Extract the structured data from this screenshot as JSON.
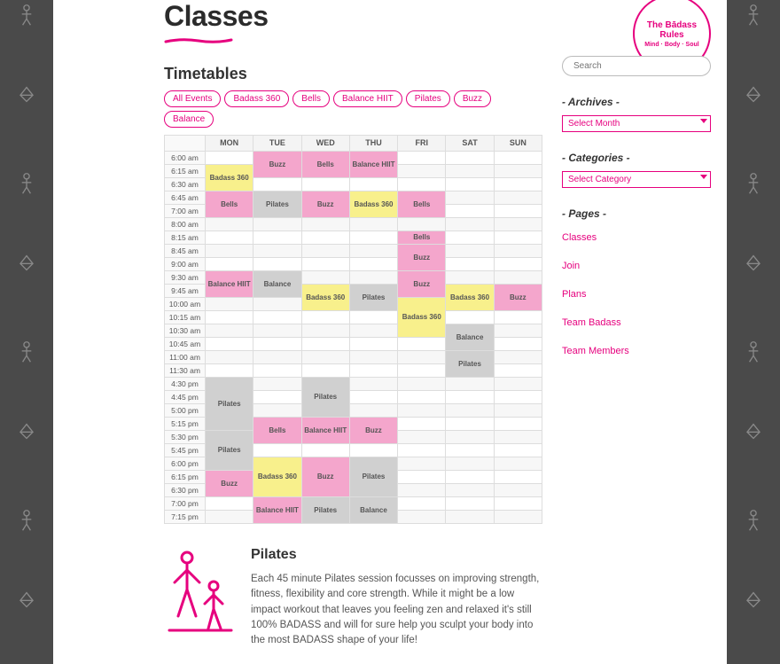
{
  "title": "Classes",
  "timetables_heading": "Timetables",
  "filters": [
    "All Events",
    "Badass 360",
    "Bells",
    "Balance HIIT",
    "Pilates",
    "Buzz",
    "Balance"
  ],
  "days": [
    "MON",
    "TUE",
    "WED",
    "THU",
    "FRI",
    "SAT",
    "SUN"
  ],
  "times": [
    "6:00 am",
    "6:15 am",
    "6:30 am",
    "6:45 am",
    "7:00 am",
    "8:00 am",
    "8:15 am",
    "8:45 am",
    "9:00 am",
    "9:30 am",
    "9:45 am",
    "10:00 am",
    "10:15 am",
    "10:30 am",
    "10:45 am",
    "11:00 am",
    "11:30 am",
    "4:30 pm",
    "4:45 pm",
    "5:00 pm",
    "5:15 pm",
    "5:30 pm",
    "5:45 pm",
    "6:00 pm",
    "6:15 pm",
    "6:30 pm",
    "7:00 pm",
    "7:15 pm"
  ],
  "events": [
    {
      "day": 0,
      "start": 1,
      "span": 2,
      "label": "Badass 360",
      "color": "yellow"
    },
    {
      "day": 0,
      "start": 3,
      "span": 2,
      "label": "Bells",
      "color": "pink"
    },
    {
      "day": 0,
      "start": 9,
      "span": 2,
      "label": "Balance HIIT",
      "color": "pink"
    },
    {
      "day": 0,
      "start": 17,
      "span": 4,
      "label": "Pilates",
      "color": "grey"
    },
    {
      "day": 0,
      "start": 21,
      "span": 3,
      "label": "Pilates",
      "color": "grey"
    },
    {
      "day": 0,
      "start": 24,
      "span": 2,
      "label": "Buzz",
      "color": "pink"
    },
    {
      "day": 1,
      "start": 0,
      "span": 2,
      "label": "Buzz",
      "color": "pink"
    },
    {
      "day": 1,
      "start": 3,
      "span": 2,
      "label": "Pilates",
      "color": "grey"
    },
    {
      "day": 1,
      "start": 9,
      "span": 2,
      "label": "Balance",
      "color": "grey"
    },
    {
      "day": 1,
      "start": 20,
      "span": 2,
      "label": "Bells",
      "color": "pink"
    },
    {
      "day": 1,
      "start": 23,
      "span": 3,
      "label": "Badass 360",
      "color": "yellow"
    },
    {
      "day": 1,
      "start": 26,
      "span": 2,
      "label": "Balance HIIT",
      "color": "pink"
    },
    {
      "day": 2,
      "start": 0,
      "span": 2,
      "label": "Bells",
      "color": "pink"
    },
    {
      "day": 2,
      "start": 3,
      "span": 2,
      "label": "Buzz",
      "color": "pink"
    },
    {
      "day": 2,
      "start": 10,
      "span": 2,
      "label": "Badass 360",
      "color": "yellow"
    },
    {
      "day": 2,
      "start": 17,
      "span": 3,
      "label": "Pilates",
      "color": "grey"
    },
    {
      "day": 2,
      "start": 20,
      "span": 2,
      "label": "Balance HIIT",
      "color": "pink"
    },
    {
      "day": 2,
      "start": 23,
      "span": 3,
      "label": "Buzz",
      "color": "pink"
    },
    {
      "day": 2,
      "start": 26,
      "span": 2,
      "label": "Pilates",
      "color": "grey"
    },
    {
      "day": 3,
      "start": 0,
      "span": 2,
      "label": "Balance HIIT",
      "color": "pink"
    },
    {
      "day": 3,
      "start": 3,
      "span": 2,
      "label": "Badass 360",
      "color": "yellow"
    },
    {
      "day": 3,
      "start": 10,
      "span": 2,
      "label": "Pilates",
      "color": "grey"
    },
    {
      "day": 3,
      "start": 20,
      "span": 2,
      "label": "Buzz",
      "color": "pink"
    },
    {
      "day": 3,
      "start": 23,
      "span": 3,
      "label": "Pilates",
      "color": "grey"
    },
    {
      "day": 3,
      "start": 26,
      "span": 2,
      "label": "Balance",
      "color": "grey"
    },
    {
      "day": 4,
      "start": 3,
      "span": 2,
      "label": "Bells",
      "color": "pink"
    },
    {
      "day": 4,
      "start": 6,
      "span": 1,
      "label": "Bells",
      "color": "pink"
    },
    {
      "day": 4,
      "start": 7,
      "span": 2,
      "label": "Buzz",
      "color": "pink"
    },
    {
      "day": 4,
      "start": 9,
      "span": 2,
      "label": "Buzz",
      "color": "pink"
    },
    {
      "day": 4,
      "start": 11,
      "span": 3,
      "label": "Badass 360",
      "color": "yellow"
    },
    {
      "day": 5,
      "start": 10,
      "span": 2,
      "label": "Badass 360",
      "color": "yellow"
    },
    {
      "day": 5,
      "start": 13,
      "span": 2,
      "label": "Balance",
      "color": "grey"
    },
    {
      "day": 5,
      "start": 15,
      "span": 2,
      "label": "Pilates",
      "color": "grey"
    },
    {
      "day": 6,
      "start": 10,
      "span": 2,
      "label": "Buzz",
      "color": "pink"
    }
  ],
  "search_placeholder": "Search",
  "widgets": {
    "archives": "- Archives -",
    "archives_sel": "Select Month",
    "categories": "- Categories -",
    "categories_sel": "Select Category",
    "pages": "- Pages -"
  },
  "pages": [
    "Classes",
    "Join",
    "Plans",
    "Team Badass",
    "Team Members"
  ],
  "badge": {
    "title": "The Bādass Rules",
    "sub": "Mind · Body · Soul"
  },
  "article": {
    "title": "Pilates",
    "body": "Each 45 minute Pilates session focusses on improving strength, fitness, flexibility and core strength. While it might be a low impact workout that leaves you feeling zen and relaxed it's still 100% BADASS and will for sure help you sculpt your body into the most BADASS shape of your life!"
  }
}
